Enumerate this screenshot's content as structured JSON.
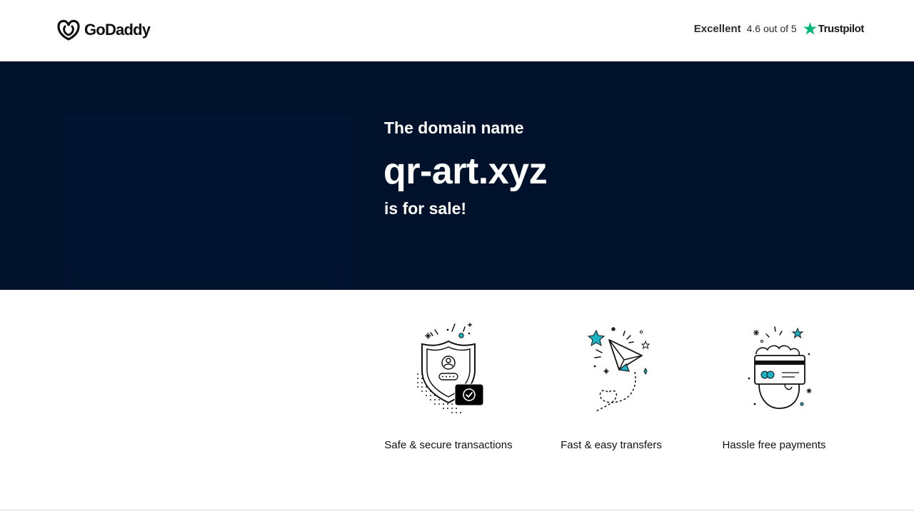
{
  "header": {
    "brand": "GoDaddy",
    "logo_icon": "godaddy-logo-icon",
    "rating": {
      "word": "Excellent",
      "score_text": "4.6 out of 5",
      "provider": "Trustpilot",
      "star_color": "#00b67a"
    }
  },
  "hero": {
    "pre": "The domain name",
    "domain": "qr-art.xyz",
    "post": "is for sale!",
    "background": "#00112b"
  },
  "features": [
    {
      "icon": "shield-check-icon",
      "label": "Safe & secure transactions"
    },
    {
      "icon": "paper-plane-icon",
      "label": "Fast & easy transfers"
    },
    {
      "icon": "hand-card-icon",
      "label": "Hassle free payments"
    }
  ],
  "accent_color": "#1bb3c4"
}
